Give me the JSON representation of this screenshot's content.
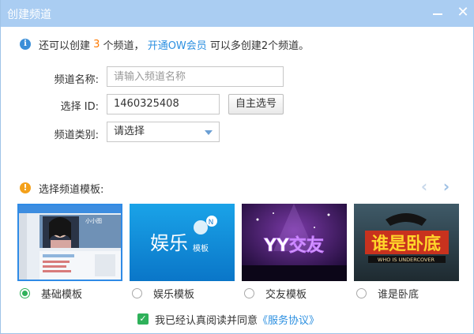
{
  "window": {
    "title": "创建频道",
    "close_glyph": "✕"
  },
  "info": {
    "prefix": "还可以创建 ",
    "count": "3",
    "middle": " 个频道， ",
    "link": "开通OW会员",
    "suffix": " 可以多创建2个频道。"
  },
  "form": {
    "name_label": "频道名称:",
    "name_placeholder": "请输入频道名称",
    "id_label": "选择 ID:",
    "id_value": "1460325408",
    "id_button": "自主选号",
    "category_label": "频道类别:",
    "category_value": "请选择"
  },
  "templates": {
    "heading": "选择频道模板:",
    "prev_glyph": "‹",
    "next_glyph": "›",
    "items": [
      {
        "label": "基础模板",
        "selected": true,
        "thumb_text": "小小图"
      },
      {
        "label": "娱乐模板",
        "selected": false,
        "thumb_text": "娱乐",
        "thumb_sub": "模板"
      },
      {
        "label": "交友模板",
        "selected": false,
        "thumb_text": "YY交友"
      },
      {
        "label": "谁是卧底",
        "selected": false,
        "thumb_text": "谁是卧底",
        "thumb_sub": "WHO IS UNDERCOVER"
      }
    ]
  },
  "agreement": {
    "checked": true,
    "check_glyph": "✓",
    "text": "我已经认真阅读并同意",
    "link": "《服务协议》"
  },
  "colors": {
    "titlebar": "#aacdf2",
    "accent": "#2b8fe0",
    "count": "#ff7a00",
    "success": "#2fb15a"
  }
}
